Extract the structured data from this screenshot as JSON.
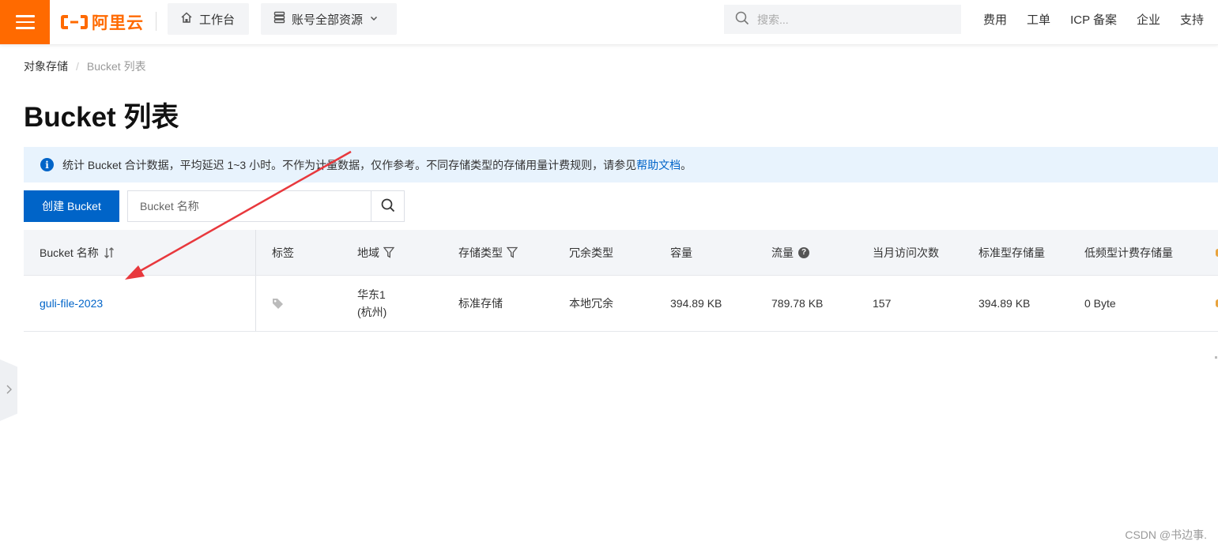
{
  "header": {
    "logo_text": "阿里云",
    "console_label": "工作台",
    "resources_label": "账号全部资源",
    "search_placeholder": "搜索...",
    "links": [
      "费用",
      "工单",
      "ICP 备案",
      "企业",
      "支持"
    ],
    "brand_color": "#ff6a00"
  },
  "breadcrumb": [
    "对象存储",
    "Bucket 列表"
  ],
  "page_title": "Bucket 列表",
  "info": {
    "text": "统计 Bucket 合计数据，平均延迟 1~3 小时。不作为计量数据，仅作参考。不同存储类型的存储用量计费规则，请参见",
    "link": "帮助文档",
    "suffix": "。"
  },
  "toolbar": {
    "create_label": "创建 Bucket",
    "search_placeholder": "Bucket 名称"
  },
  "table": {
    "columns": [
      "Bucket 名称",
      "标签",
      "地域",
      "存储类型",
      "冗余类型",
      "容量",
      "流量",
      "当月访问次数",
      "标准型存储量",
      "低频型计费存储量"
    ],
    "rows": [
      {
        "name": "guli-file-2023",
        "region_line1": "华东1",
        "region_line2": "(杭州)",
        "storage_type": "标准存储",
        "redundancy": "本地冗余",
        "capacity": "394.89 KB",
        "traffic": "789.78 KB",
        "visits": "157",
        "standard_storage": "394.89 KB",
        "ia_storage": "0 Byte"
      }
    ]
  },
  "watermark": "CSDN @书边事.",
  "accent_color": "#0064c8",
  "annotation_color": "#e8383d"
}
